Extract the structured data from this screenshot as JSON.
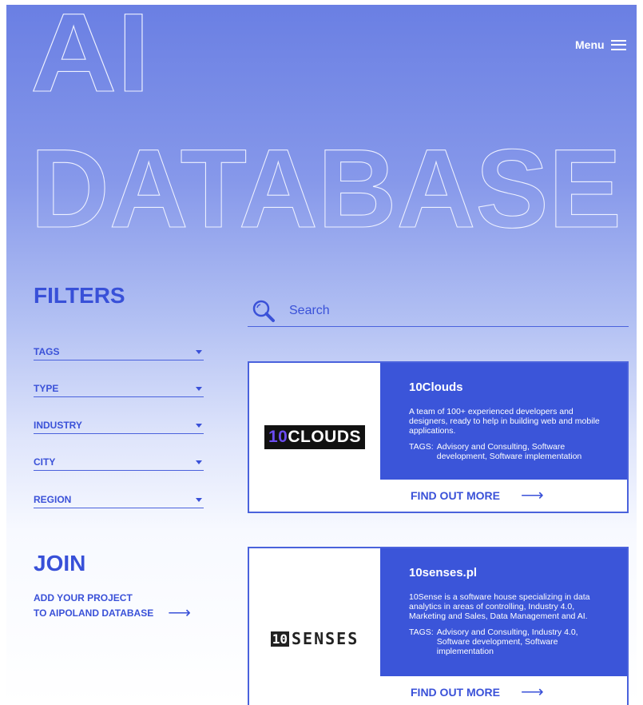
{
  "hero": {
    "line1": "AI",
    "line2": "DATABASE"
  },
  "nav": {
    "menu_label": "Menu"
  },
  "filters": {
    "title": "FILTERS",
    "items": [
      {
        "label": "TAGS"
      },
      {
        "label": "TYPE"
      },
      {
        "label": "INDUSTRY"
      },
      {
        "label": "CITY"
      },
      {
        "label": "REGION"
      }
    ]
  },
  "search": {
    "placeholder": "Search",
    "value": ""
  },
  "join": {
    "title": "JOIN",
    "link_line1": "ADD YOUR PROJECT",
    "link_line2": "TO AIPOLAND DATABASE"
  },
  "cards": [
    {
      "title": "10Clouds",
      "logo_prefix": "10",
      "logo_text": "CLOUDS",
      "description": "A team of 100+ experienced developers and designers, ready to help in building web and mobile applications.",
      "tags_label": "TAGS:",
      "tags": "Advisory and Consulting, Software development, Software implementation",
      "cta": "FIND OUT MORE"
    },
    {
      "title": "10senses.pl",
      "logo_prefix": "10",
      "logo_text": "SENSES",
      "description": "10Sense is a software house specializing in data analytics in areas of controlling, Industry 4.0, Marketing and Sales, Data Management and AI.",
      "tags_label": "TAGS:",
      "tags": "Advisory and Consulting, Industry 4.0, Software development, Software implementation",
      "cta": "FIND OUT MORE"
    }
  ],
  "colors": {
    "accent": "#3b55d9",
    "hero_top": "#6a7fe3",
    "background": "#ffffff"
  }
}
